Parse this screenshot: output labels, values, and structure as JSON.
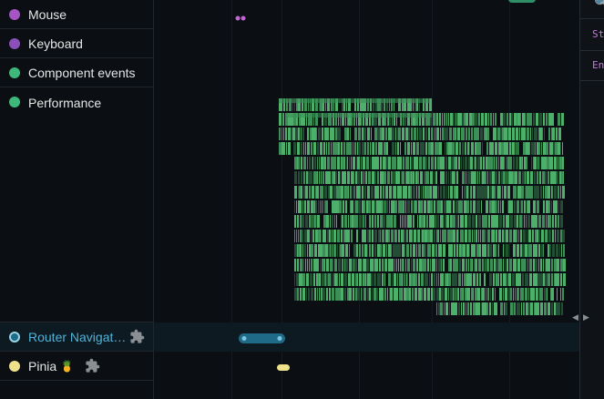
{
  "layers": [
    {
      "label": "Mouse",
      "color": "#a656c4",
      "active": false
    },
    {
      "label": "Keyboard",
      "color": "#8a4fb8",
      "active": false
    },
    {
      "label": "Component events",
      "color": "#3fb67a",
      "active": false
    },
    {
      "label": "Performance",
      "color": "#3fb67a",
      "active": false
    },
    {
      "label": "Router Navigat…",
      "color": "#1f6a86",
      "active": true,
      "plugin": true
    },
    {
      "label": "Pinia",
      "color": "#f0e28a",
      "active": false,
      "plugin": true,
      "emoji": "🍍"
    }
  ],
  "icons": {
    "plugin": "puzzle-piece-icon",
    "search": "search-icon",
    "scroll_left": "chevron-left-icon",
    "scroll_right": "chevron-right-icon"
  },
  "right_panel": {
    "line1": "St",
    "line2": "En",
    "search_glyph": "🔍",
    "arrow_left": "◀",
    "arrow_right": "▶"
  },
  "colors": {
    "router_event": "#1f6a86",
    "pinia_event": "#f0e28a",
    "perf_bright": "#4caf6a",
    "perf_mid": "#3b8f57",
    "perf_dark": "#244d36"
  }
}
